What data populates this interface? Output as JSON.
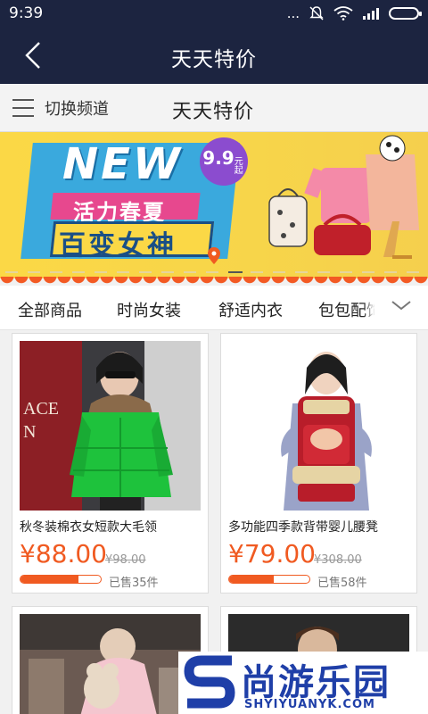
{
  "status_bar": {
    "time": "9:39",
    "dots": "...",
    "battery_color": "#ffffff"
  },
  "nav": {
    "title": "天天特价",
    "background": "#1c2440"
  },
  "channel": {
    "switch_label": "切换频道",
    "title": "天天特价"
  },
  "banner": {
    "new_text": "NEW",
    "line1": "活力春夏",
    "line2": "百变女神",
    "price_num": "9.9",
    "price_unit": "元起",
    "active_slide": 1,
    "slides": 2
  },
  "tabs": [
    "全部商品",
    "时尚女装",
    "舒适内衣",
    "包包配饰"
  ],
  "accent_color": "#f05a21",
  "products": [
    {
      "title": "秋冬装棉衣女短款大毛领",
      "price": "¥88.00",
      "original_price": "¥98.00",
      "sold_text": "已售35件",
      "progress": 0.72,
      "image_icon": "green-down-jacket-photo"
    },
    {
      "title": "多功能四季款背带婴儿腰凳",
      "price": "¥79.00",
      "original_price": "¥308.00",
      "sold_text": "已售58件",
      "progress": 0.55,
      "image_icon": "baby-carrier-photo"
    },
    {
      "title": "",
      "price": "",
      "original_price": "",
      "sold_text": "",
      "progress": 0,
      "image_icon": "pink-coat-photo"
    },
    {
      "title": "",
      "price": "",
      "original_price": "",
      "sold_text": "",
      "progress": 0,
      "image_icon": "mens-suit-photo"
    }
  ],
  "watermark": {
    "chinese": "尚游乐园",
    "english": "SHYIYUANYK.COM"
  }
}
